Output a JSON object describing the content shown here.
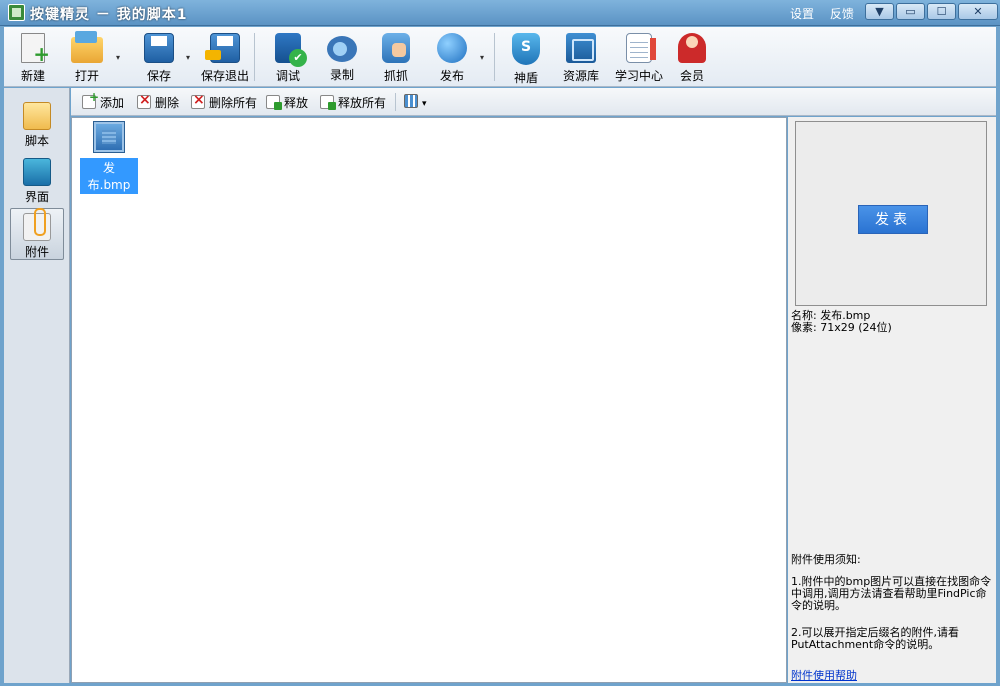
{
  "window": {
    "title": "按键精灵 － 我的脚本1",
    "links": [
      "设置",
      "反馈"
    ],
    "controls": {
      "dropdown": "▼",
      "minimize": "▭",
      "maximize": "☐",
      "close": "✕"
    }
  },
  "toolbar": {
    "items": [
      "新建",
      "打开",
      "保存",
      "保存退出",
      "调试",
      "录制",
      "抓抓",
      "发布",
      "神盾",
      "资源库",
      "学习中心",
      "会员"
    ],
    "dropdown_arrow": "▾"
  },
  "leftnav": {
    "items": [
      "脚本",
      "界面",
      "附件"
    ],
    "active": "附件"
  },
  "subbar": {
    "items": [
      "添加",
      "删除",
      "删除所有",
      "释放",
      "释放所有"
    ],
    "view_dropdown": "▾"
  },
  "files": [
    {
      "name": "发布.bmp",
      "selected": true
    }
  ],
  "preview": {
    "button_label": "发表",
    "name_line": "名称: 发布.bmp",
    "pixel_line": "像素: 71x29 (24位)"
  },
  "notes": {
    "title": "附件使用须知:",
    "items": [
      "1.附件中的bmp图片可以直接在找图命令中调用,调用方法请查看帮助里FindPic命令的说明。",
      "2.可以展开指定后缀名的附件,请看PutAttachment命令的说明。"
    ],
    "help_link": "附件使用帮助"
  },
  "colors": {
    "titlebar": "#5b93c4",
    "selection": "#3399ff",
    "publish_button": "#2a73d2",
    "link": "#0033cc"
  }
}
